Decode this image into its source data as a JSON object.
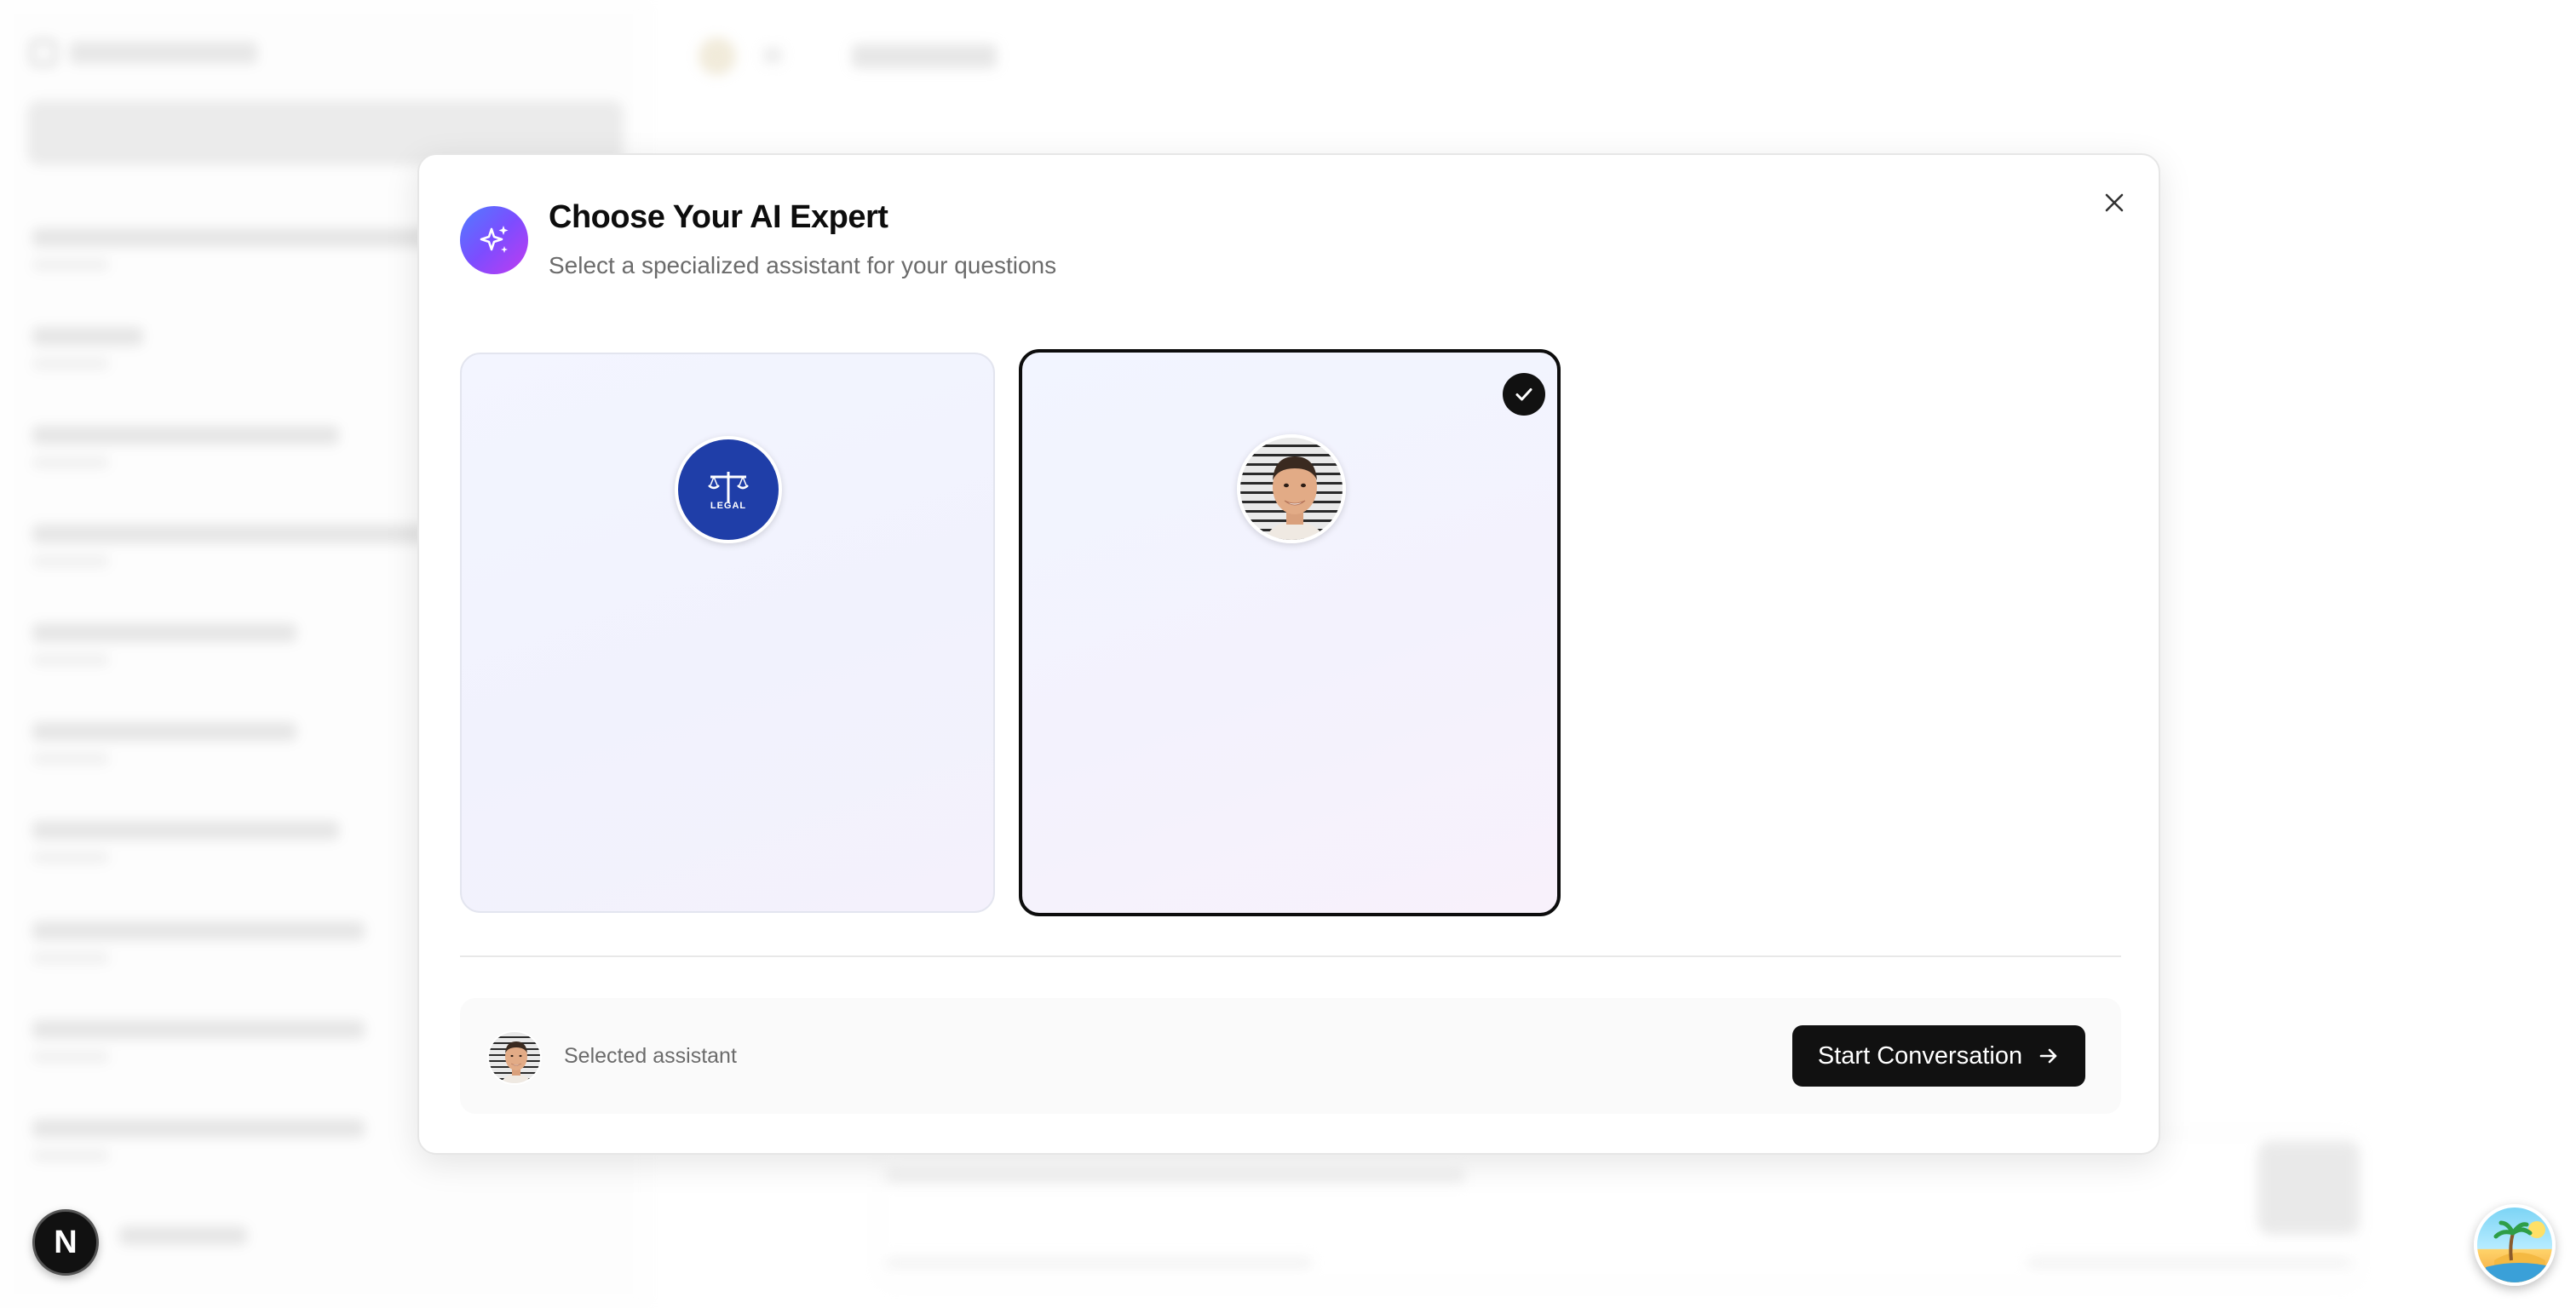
{
  "modal": {
    "title": "Choose Your AI Expert",
    "subtitle": "Select a specialized assistant for your questions",
    "header_icon": "sparkles-icon",
    "close_icon": "close-icon"
  },
  "assistants": [
    {
      "id": "legal",
      "avatar_text": "LEGAL",
      "avatar_icon": "scales-of-justice-icon",
      "avatar_color": "#1f3ea8",
      "selected": false
    },
    {
      "id": "person",
      "avatar_icon": "person-photo",
      "selected": true
    }
  ],
  "footer": {
    "selected_label": "Selected assistant",
    "start_button_label": "Start Conversation",
    "start_button_icon": "arrow-right-icon"
  },
  "badges": {
    "next_letter": "N"
  },
  "colors": {
    "accent_dark": "#111111",
    "legal_blue": "#1f3ea8",
    "header_gradient_start": "#4f7dff",
    "header_gradient_end": "#c13bf0"
  }
}
